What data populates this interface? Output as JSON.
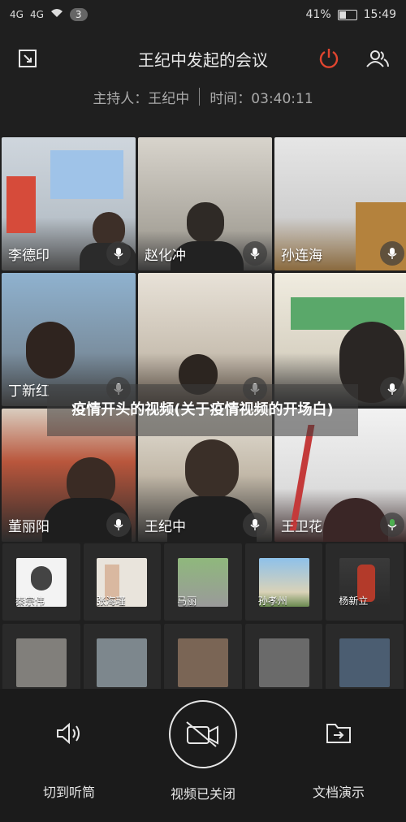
{
  "status_bar": {
    "signal1": "4G",
    "signal2": "4G",
    "notification_count": "3",
    "battery": "41%",
    "time": "15:49"
  },
  "header": {
    "title": "王纪中发起的会议"
  },
  "info": {
    "host": "主持人：王纪中",
    "time": "时间：03:40:11"
  },
  "participants": [
    {
      "name": "李德印"
    },
    {
      "name": "赵化冲"
    },
    {
      "name": "孙连海"
    },
    {
      "name": "丁新红"
    },
    {
      "name": ""
    },
    {
      "name": ""
    },
    {
      "name": "董丽阳"
    },
    {
      "name": "王纪中"
    },
    {
      "name": "王卫花"
    }
  ],
  "thumbnails": [
    {
      "name": "秦宗伟"
    },
    {
      "name": "张海瑾"
    },
    {
      "name": "马丽"
    },
    {
      "name": "孙孝州"
    },
    {
      "name": "杨新立"
    },
    {
      "name": ""
    },
    {
      "name": ""
    },
    {
      "name": ""
    },
    {
      "name": ""
    },
    {
      "name": ""
    }
  ],
  "overlay_caption": "疫情开头的视频(关于疫情视频的开场白)",
  "footer": {
    "earpiece": "切到听筒",
    "video_off": "视频已关闭",
    "doc_share": "文档演示"
  },
  "colors": {
    "end_button": "#e0452f"
  }
}
